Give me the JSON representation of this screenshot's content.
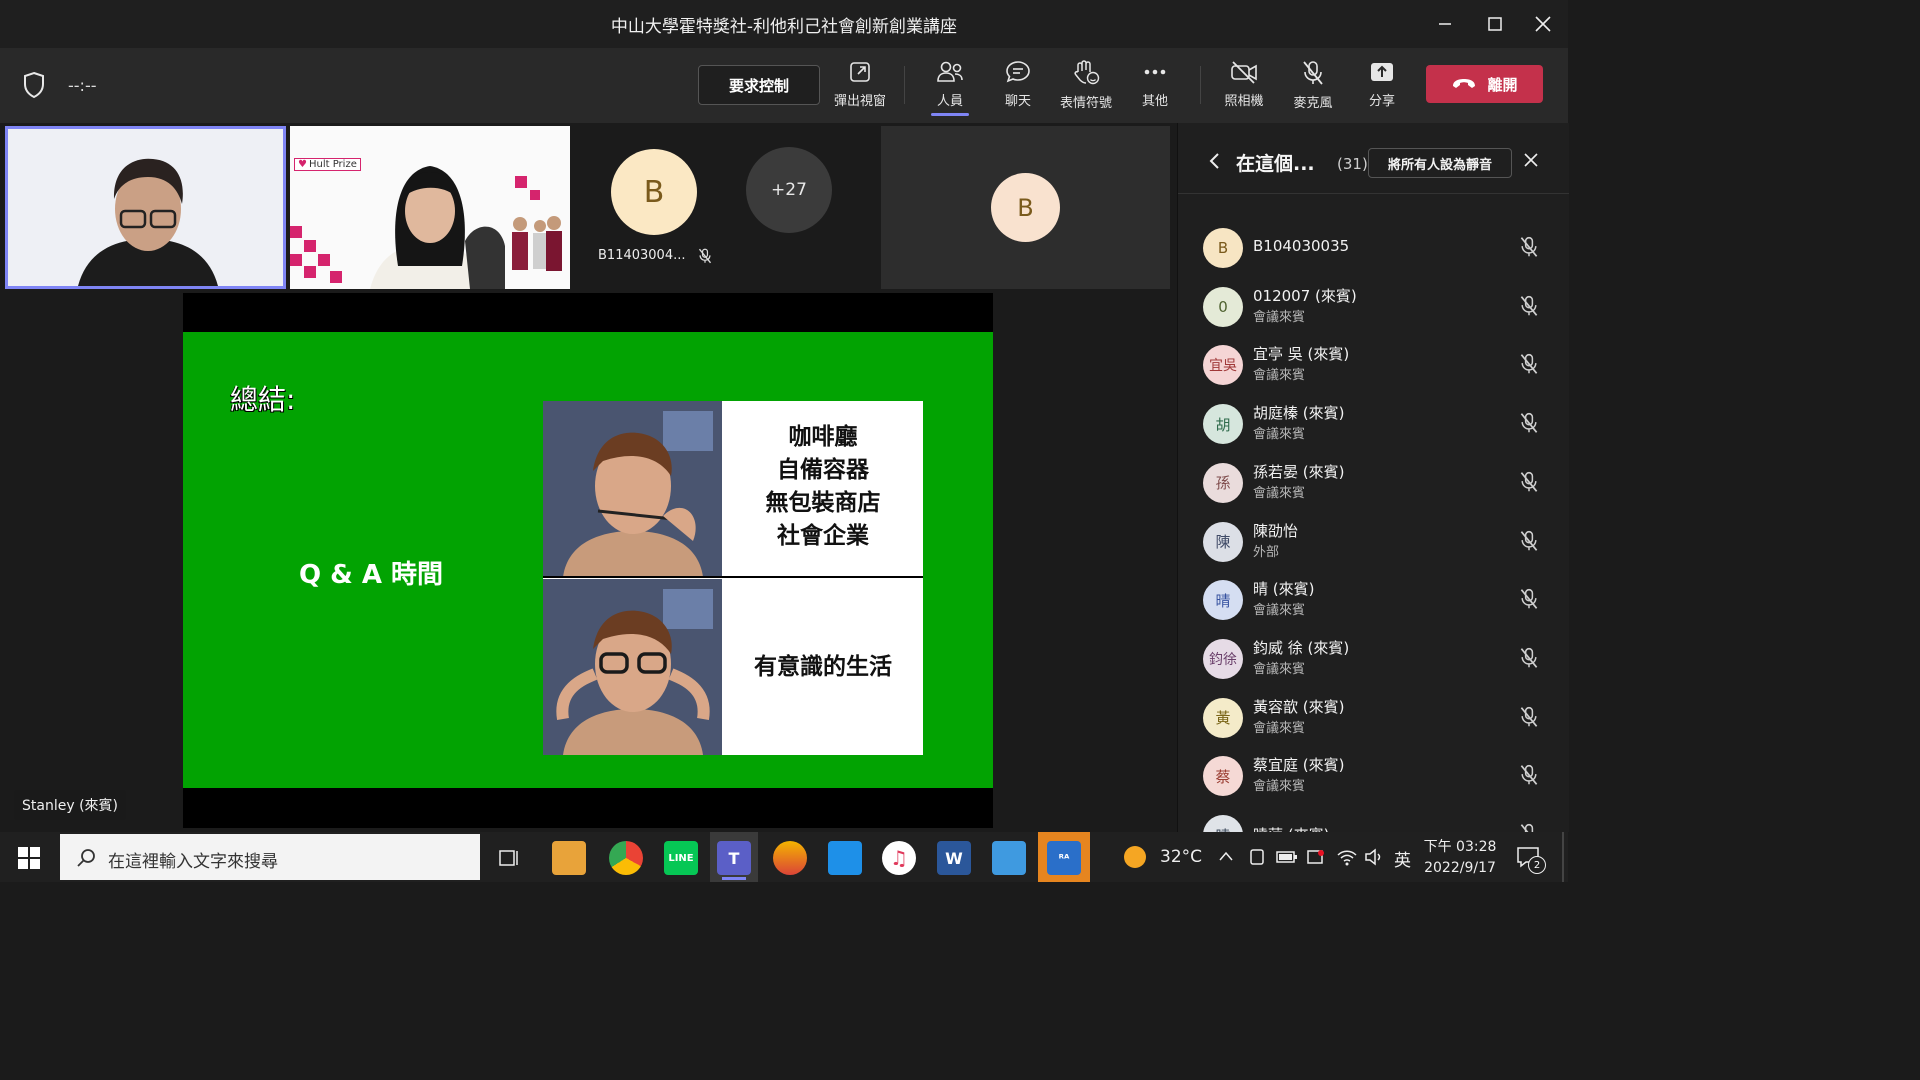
{
  "window": {
    "title": "中山大學霍特獎社-利他利己社會創新創業講座"
  },
  "toolbar": {
    "timer": "--:--",
    "request_control": "要求控制",
    "popout": "彈出視窗",
    "people": "人員",
    "chat": "聊天",
    "reactions": "表情符號",
    "more": "其他",
    "camera": "照相機",
    "mic": "麥克風",
    "share": "分享",
    "leave": "離開"
  },
  "stage": {
    "tile2_badge": "Hult Prize",
    "tile3_initial": "B",
    "tile3_name": "B11403004...",
    "overflow_count": "+27",
    "tile5_initial": "B",
    "speaker_label": "Stanley (來賓)"
  },
  "slide": {
    "heading": "總結:",
    "qa": "Q & A 時間",
    "meme_top": [
      "咖啡廳",
      "自備容器",
      "無包裝商店",
      "社會企業"
    ],
    "meme_bottom": "有意識的生活",
    "bg_color": "#02a302"
  },
  "panel": {
    "title": "在這個...",
    "count": "(31)",
    "mute_all": "將所有人設為靜音",
    "participants": [
      {
        "initial": "B",
        "name": "B104030035",
        "sub": "",
        "color": "#f7e5c3",
        "fg": "#7a5a1c"
      },
      {
        "initial": "0",
        "name": "012007 (來賓)",
        "sub": "會議來賓",
        "color": "#e4ead7",
        "fg": "#4f6230"
      },
      {
        "initial": "宜吳",
        "name": "宜亭 吳 (來賓)",
        "sub": "會議來賓",
        "color": "#f5d5d5",
        "fg": "#a03838"
      },
      {
        "initial": "胡",
        "name": "胡庭榛 (來賓)",
        "sub": "會議來賓",
        "color": "#d6e6dd",
        "fg": "#2f6b4c"
      },
      {
        "initial": "孫",
        "name": "孫若晏 (來賓)",
        "sub": "會議來賓",
        "color": "#eadcdc",
        "fg": "#7d4a4a"
      },
      {
        "initial": "陳",
        "name": "陳劭怡",
        "sub": "外部",
        "color": "#dcdfe6",
        "fg": "#3f4a66"
      },
      {
        "initial": "晴",
        "name": "晴 (來賓)",
        "sub": "會議來賓",
        "color": "#d5def2",
        "fg": "#3652a0"
      },
      {
        "initial": "鈞徐",
        "name": "鈞威 徐 (來賓)",
        "sub": "會議來賓",
        "color": "#e6dbe6",
        "fg": "#6a3f6a"
      },
      {
        "initial": "黃",
        "name": "黃容歆 (來賓)",
        "sub": "會議來賓",
        "color": "#f4ebc9",
        "fg": "#7a6518"
      },
      {
        "initial": "蔡",
        "name": "蔡宜庭 (來賓)",
        "sub": "會議來賓",
        "color": "#f5d9d5",
        "fg": "#9a3d32"
      },
      {
        "initial": "曉",
        "name": "曉萍 (來賓)",
        "sub": "",
        "color": "#dfe3e8",
        "fg": "#3d4b5c"
      }
    ]
  },
  "taskbar": {
    "search_placeholder": "在這裡輸入文字來搜尋",
    "weather": "32°C",
    "ime": "英",
    "time": "下午 03:28",
    "date": "2022/9/17",
    "notif_count": "2"
  }
}
